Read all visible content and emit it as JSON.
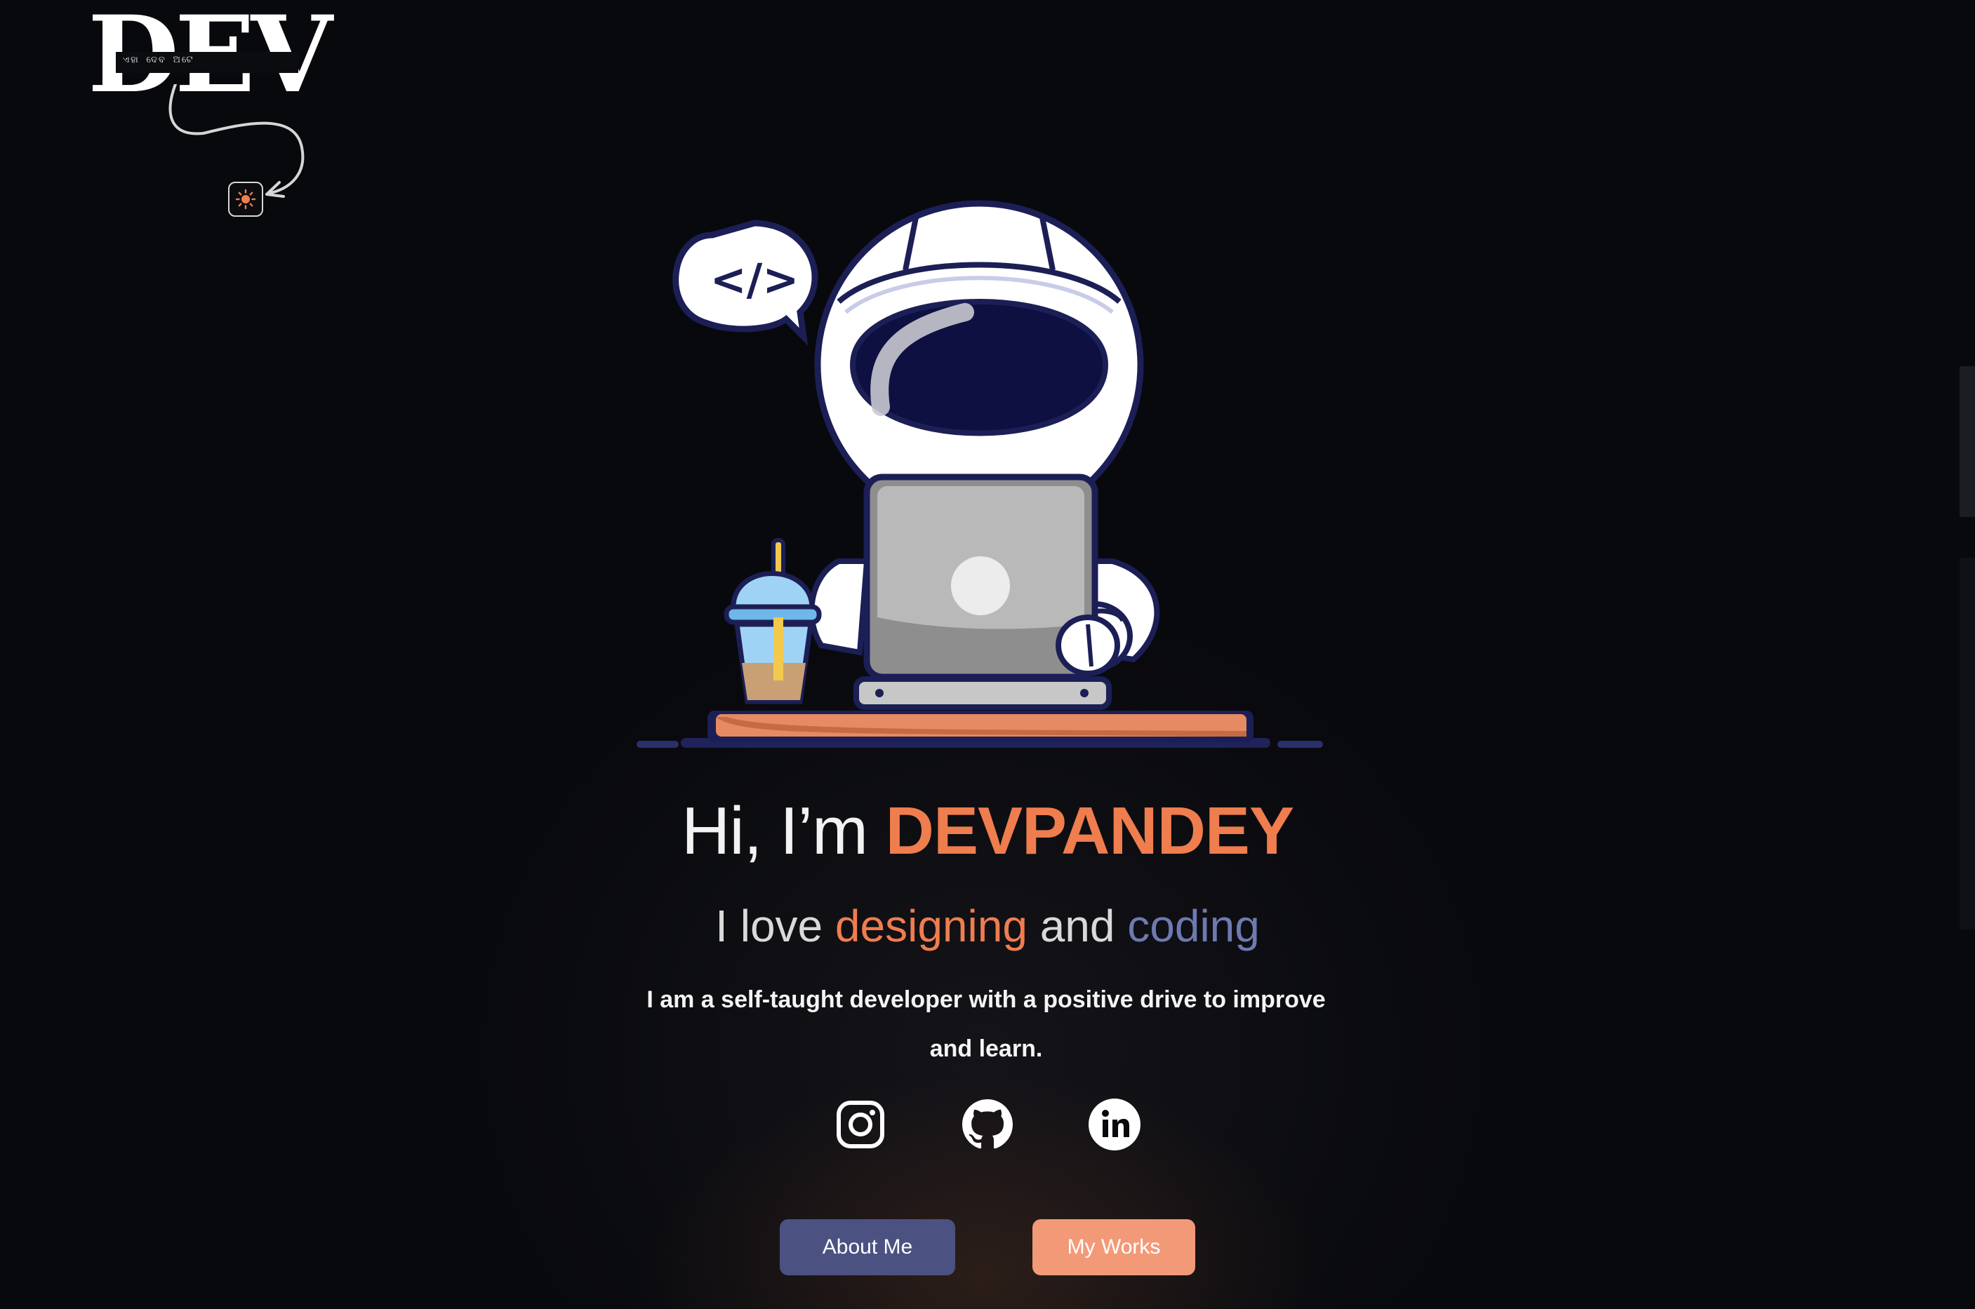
{
  "logo": {
    "text": "DEV",
    "subtitle": "ଏହା ଦେବ ଅଟେ",
    "icon": "logo"
  },
  "theme_toggle": {
    "icon": "sun-icon",
    "color": "#ef7d4e"
  },
  "hero": {
    "illustration": "astronaut-at-laptop",
    "speech_bubble": "</>",
    "greeting_prefix": "Hi, I’m ",
    "name": "DEVPANDEY",
    "tagline": {
      "part1": "I love ",
      "word1": "designing",
      "part2": " and ",
      "word2": "coding"
    },
    "bio": "I am a self-taught developer with a positive drive to improve and learn."
  },
  "socials": [
    {
      "name": "Instagram",
      "icon": "instagram-icon"
    },
    {
      "name": "GitHub",
      "icon": "github-icon"
    },
    {
      "name": "LinkedIn",
      "icon": "linkedin-icon"
    }
  ],
  "buttons": {
    "about": "About Me",
    "works": "My Works"
  },
  "colors": {
    "background": "#08090d",
    "accent_orange": "#ef7d4e",
    "accent_blue": "#6e7ab0",
    "button_about": "#4b5282",
    "button_works": "#f29a78"
  }
}
